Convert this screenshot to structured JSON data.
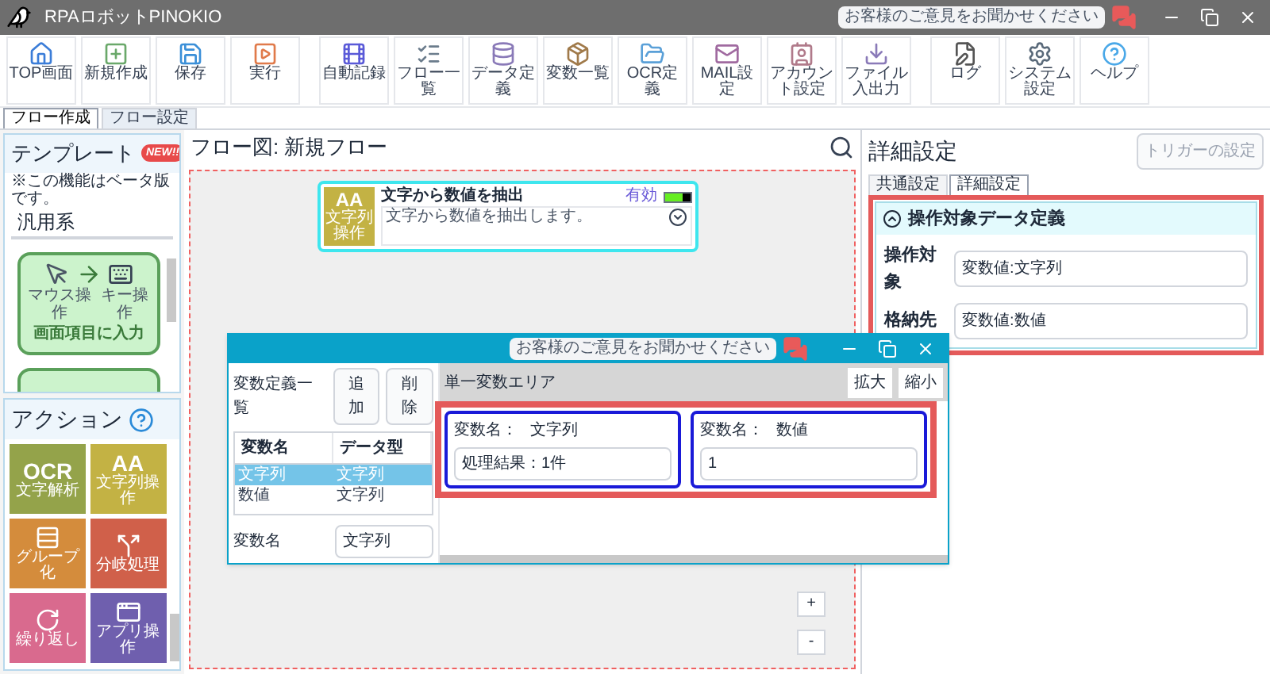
{
  "window": {
    "title": "RPAロボットPINOKIO",
    "feedback": "お客様のご意見をお聞かせください"
  },
  "toolbar": [
    [
      "TOP画面",
      "新規作成",
      "保存",
      "実行"
    ],
    [
      "自動記録",
      "フロー一覧",
      "データ定義",
      "変数一覧",
      "OCR定義",
      "MAIL設定",
      "アカウント設定",
      "ファイル入出力"
    ],
    [
      "ログ",
      "システム設定",
      "ヘルプ"
    ]
  ],
  "mode_tabs": [
    {
      "label": "フロー作成",
      "selected": true
    },
    {
      "label": "フロー設定",
      "selected": false
    }
  ],
  "templates": {
    "title": "テンプレート",
    "badge": "NEW!!",
    "note": "※この機能はベータ版です。",
    "category": "汎用系",
    "card": {
      "title": "画面項目に入力",
      "steps": [
        "マウス操作",
        "キー操作"
      ]
    }
  },
  "actions": {
    "title": "アクション",
    "items": [
      {
        "kind": "glyph",
        "glyph": "OCR",
        "label": "文字解析",
        "color": "#94a34a"
      },
      {
        "kind": "glyph",
        "glyph": "AA",
        "label": "文字列操作",
        "color": "#c3b244"
      },
      {
        "kind": "icon",
        "label": "グループ化",
        "color": "#d48c3c"
      },
      {
        "kind": "icon",
        "label": "分岐処理",
        "color": "#d0604a"
      },
      {
        "kind": "icon",
        "label": "繰り返し",
        "color": "#d96a8e"
      },
      {
        "kind": "icon",
        "label": "アプリ操作",
        "color": "#6f5fae"
      }
    ]
  },
  "flow": {
    "title": "フロー図: 新規フロー",
    "node": {
      "glyph": "AA",
      "category": "文字列操作",
      "title": "文字から数値を抽出",
      "enabled_label": "有効",
      "enabled": true,
      "description": "文字から数値を抽出します。"
    },
    "zoom_buttons": [
      "+",
      "-"
    ]
  },
  "popup": {
    "feedback": "お客様のご意見をお聞かせください",
    "list_title": "変数定義一覧",
    "buttons": [
      "追加",
      "削除"
    ],
    "columns": [
      "変数名",
      "データ型"
    ],
    "rows": [
      {
        "cells": [
          "文字列",
          "文字列"
        ],
        "selected": true
      },
      {
        "cells": [
          "数値",
          "文字列"
        ],
        "selected": false
      }
    ],
    "name_label": "変数名",
    "name_value": "文字列",
    "area_title": "単一変数エリア",
    "area_buttons": [
      "拡大",
      "縮小"
    ],
    "variables": [
      {
        "label": "変数名：",
        "name": "文字列",
        "value": "処理結果：1件"
      },
      {
        "label": "変数名：",
        "name": "数値",
        "value": "1"
      }
    ]
  },
  "details": {
    "title": "詳細設定",
    "trigger_button": {
      "label": "トリガーの設定",
      "disabled": true
    },
    "tabs": [
      {
        "label": "共通設定",
        "selected": false
      },
      {
        "label": "詳細設定",
        "selected": true
      }
    ],
    "section": {
      "title": "操作対象データ定義",
      "expanded": true,
      "fields": [
        {
          "label": "操作対象",
          "value": "変数値:文字列"
        },
        {
          "label": "格納先",
          "value": "変数値:数値"
        }
      ]
    }
  }
}
